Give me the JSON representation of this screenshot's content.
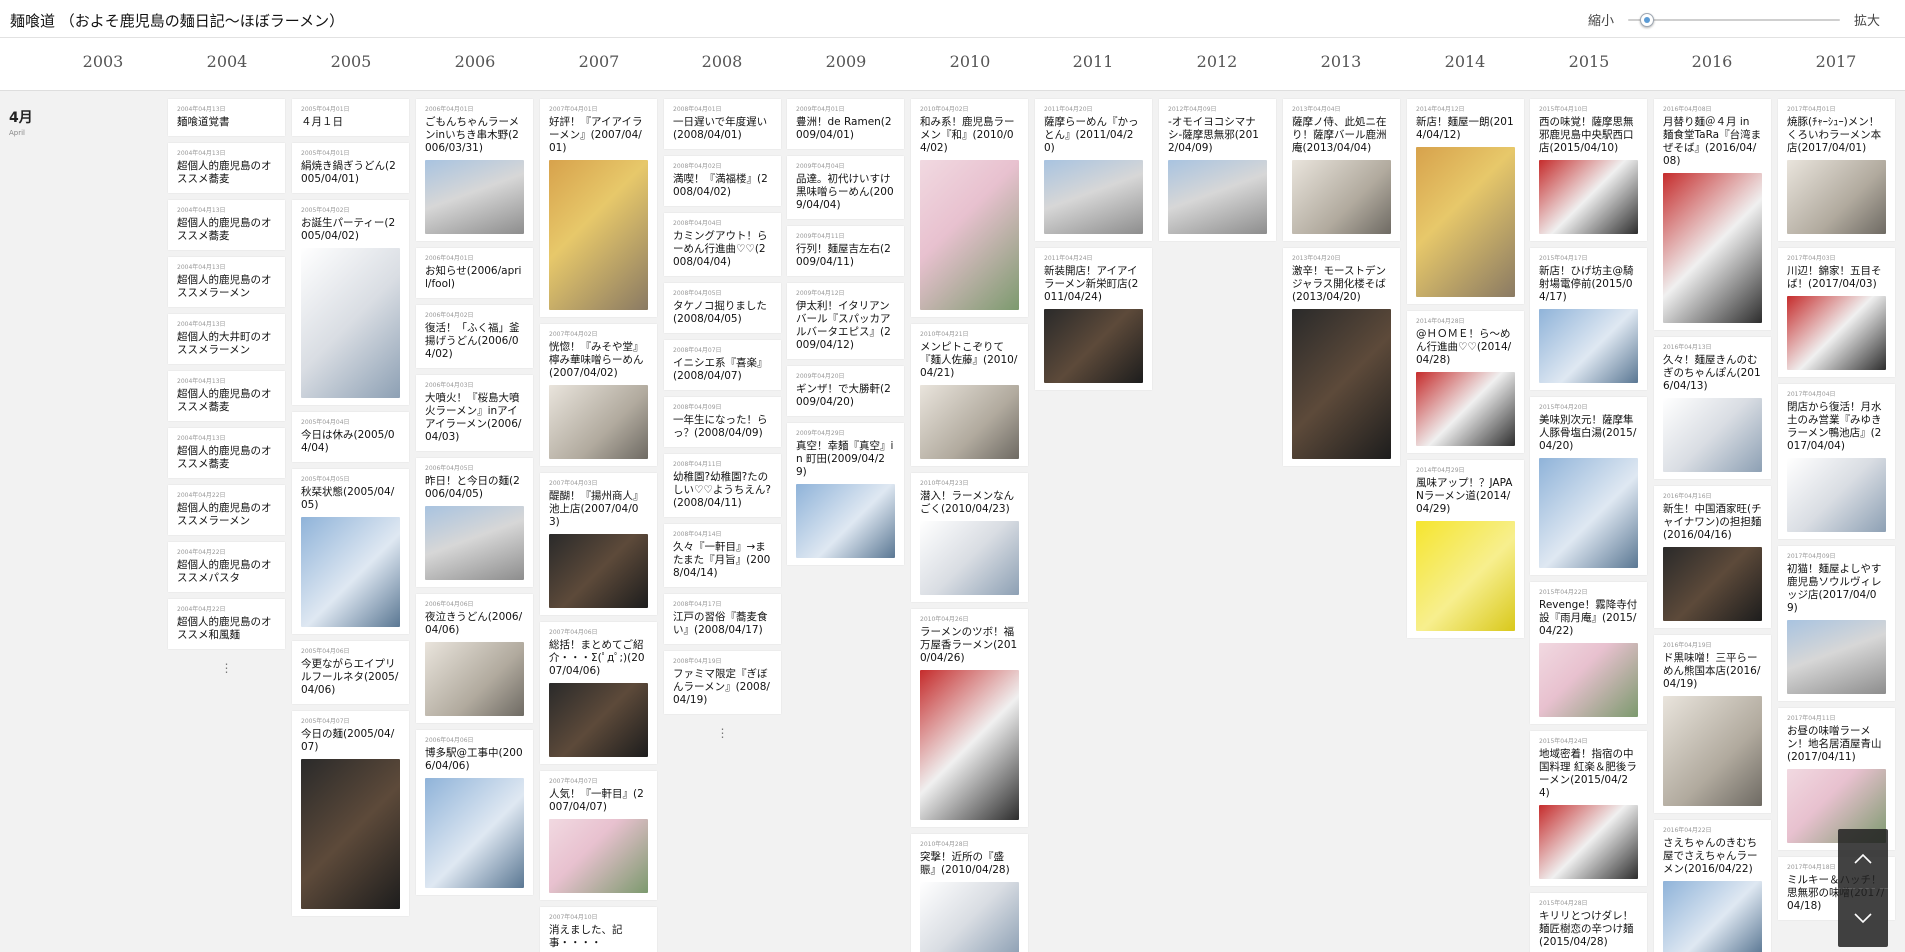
{
  "site_title": "麺喰道 （およそ鹿児島の麺日記〜ほぼラーメン）",
  "zoom": {
    "out_label": "縮小",
    "in_label": "拡大",
    "level": 0.06
  },
  "years": [
    "2003",
    "2004",
    "2005",
    "2006",
    "2007",
    "2008",
    "2009",
    "2010",
    "2011",
    "2012",
    "2013",
    "2014",
    "2015",
    "2016",
    "2017"
  ],
  "month": {
    "label": "4月",
    "sub": "April"
  },
  "more_glyph": "⋮",
  "columns": [
    {
      "year": "2004",
      "more": true,
      "items": [
        {
          "date": "2004年04月13日",
          "title": "麺喰道覚書"
        },
        {
          "date": "2004年04月13日",
          "title": "超個人的鹿児島のオススメ蕎麦"
        },
        {
          "date": "2004年04月13日",
          "title": "超個人的鹿児島のオススメ蕎麦"
        },
        {
          "date": "2004年04月13日",
          "title": "超個人的鹿児島のオススメラーメン"
        },
        {
          "date": "2004年04月13日",
          "title": "超個人的大井町のオススメラーメン"
        },
        {
          "date": "2004年04月13日",
          "title": "超個人的鹿児島のオススメ蕎麦"
        },
        {
          "date": "2004年04月13日",
          "title": "超個人的鹿児島のオススメ蕎麦"
        },
        {
          "date": "2004年04月22日",
          "title": "超個人的鹿児島のオススメラーメン"
        },
        {
          "date": "2004年04月22日",
          "title": "超個人的鹿児島のオススメパスタ"
        },
        {
          "date": "2004年04月22日",
          "title": "超個人的鹿児島のオススメ和風麺"
        }
      ]
    },
    {
      "year": "2005",
      "items": [
        {
          "date": "2005年04月01日",
          "title": "４月１日"
        },
        {
          "date": "2005年04月01日",
          "title": "絹焼き鍋ぎうどん(2005/04/01)"
        },
        {
          "date": "2005年04月02日",
          "title": "お誕生パーティー(2005/04/02)",
          "img": "t6",
          "size": "tall"
        },
        {
          "date": "2005年04月04日",
          "title": "今日は休み(2005/04/04)"
        },
        {
          "date": "2005年04月05日",
          "title": "秋栞状態(2005/04/05)",
          "img": "t9",
          "size": "mid"
        },
        {
          "date": "2005年04月06日",
          "title": "今更ながらエイプリルフールネタ(2005/04/06)"
        },
        {
          "date": "2005年04月07日",
          "title": "今日の麺(2005/04/07)",
          "img": "t3",
          "size": "tall"
        }
      ]
    },
    {
      "year": "2006",
      "items": [
        {
          "date": "2006年04月01日",
          "title": "ごもんちゃんラーメンinいちき串木野(2006/03/31)",
          "img": "t1"
        },
        {
          "date": "2006年04月01日",
          "title": "お知らせ(2006/april/fool)"
        },
        {
          "date": "2006年04月02日",
          "title": "復活！「ふく福」釜揚げうどん(2006/04/02)"
        },
        {
          "date": "2006年04月03日",
          "title": "大噴火！『桜島大噴火ラーメン』inアイアイラーメン(2006/04/03)"
        },
        {
          "date": "2006年04月05日",
          "title": "昨日！と今日の麺(2006/04/05)",
          "img": "t1"
        },
        {
          "date": "2006年04月06日",
          "title": "夜泣きうどん(2006/04/06)",
          "img": "t2"
        },
        {
          "date": "2006年04月06日",
          "title": "博多駅@工事中(2006/04/06)",
          "img": "t9",
          "size": "mid"
        }
      ]
    },
    {
      "year": "2007",
      "items": [
        {
          "date": "2007年04月01日",
          "title": "好評！『アイアイラーメン』(2007/04/01)",
          "img": "t5",
          "size": "tall"
        },
        {
          "date": "2007年04月02日",
          "title": "恍惚！『みそや堂』檸み華味噌らーめん(2007/04/02)",
          "img": "t2"
        },
        {
          "date": "2007年04月03日",
          "title": "醍醐！『揚州商人』池上店(2007/04/03)",
          "img": "t3"
        },
        {
          "date": "2007年04月06日",
          "title": "総括！まとめてご紹介・・・Σ(ﾟдﾟ;)(2007/04/06)",
          "img": "t3"
        },
        {
          "date": "2007年04月07日",
          "title": "人気！『一軒目』(2007/04/07)",
          "img": "t4"
        },
        {
          "date": "2007年04月10日",
          "title": "消えました、記事・・・・"
        }
      ]
    },
    {
      "year": "2008",
      "more": true,
      "items": [
        {
          "date": "2008年04月01日",
          "title": "一日遅いで年度遅い(2008/04/01)"
        },
        {
          "date": "2008年04月02日",
          "title": "満喫！『満福楼』(2008/04/02)"
        },
        {
          "date": "2008年04月04日",
          "title": "カミングアウト！らーめん行進曲♡♡(2008/04/04)"
        },
        {
          "date": "2008年04月05日",
          "title": "タケノコ掘りました(2008/04/05)"
        },
        {
          "date": "2008年04月07日",
          "title": "イニシエ系『喜楽』(2008/04/07)"
        },
        {
          "date": "2008年04月09日",
          "title": "一年生になった！らっ？(2008/04/09)"
        },
        {
          "date": "2008年04月11日",
          "title": "幼稚園?幼稚園?たのしい♡♡ようちえん?(2008/04/11)"
        },
        {
          "date": "2008年04月14日",
          "title": "久々『一軒目』→またまた『月旨』(2008/04/14)"
        },
        {
          "date": "2008年04月17日",
          "title": "江戸の習俗『蕎麦食い』(2008/04/17)"
        },
        {
          "date": "2008年04月19日",
          "title": "ファミマ限定『ぎぼんラーメン』(2008/04/19)"
        }
      ]
    },
    {
      "year": "2009",
      "items": [
        {
          "date": "2009年04月01日",
          "title": "豊洲！de Ramen(2009/04/01)"
        },
        {
          "date": "2009年04月04日",
          "title": "品達。初代けいすけ黒味噌らーめん(2009/04/04)"
        },
        {
          "date": "2009年04月11日",
          "title": "行列！麺屋吉左右(2009/04/11)"
        },
        {
          "date": "2009年04月12日",
          "title": "伊太利！イタリアンバール『スパッカアルバータエピス』(2009/04/12)"
        },
        {
          "date": "2009年04月20日",
          "title": "ギンザ！で大勝軒(2009/04/20)"
        },
        {
          "date": "2009年04月29日",
          "title": "真空！幸麺『真空』in 町田(2009/04/29)",
          "img": "t9"
        }
      ]
    },
    {
      "year": "2010",
      "items": [
        {
          "date": "2010年04月02日",
          "title": "和み系！鹿児島ラーメン『和』(2010/04/02)",
          "img": "t4",
          "size": "tall"
        },
        {
          "date": "2010年04月21日",
          "title": "メンピトこぞりて『麺人佐藤』(2010/04/21)",
          "img": "t2"
        },
        {
          "date": "2010年04月23日",
          "title": "潜入！ラーメンなんごく(2010/04/23)",
          "img": "t6"
        },
        {
          "date": "2010年04月26日",
          "title": "ラーメンのツボ！福万屋香ラーメン(2010/04/26)",
          "img": "t8",
          "size": "tall"
        },
        {
          "date": "2010年04月28日",
          "title": "突撃！近所の『盛賑』(2010/04/28)",
          "img": "t6"
        }
      ]
    },
    {
      "year": "2011",
      "items": [
        {
          "date": "2011年04月20日",
          "title": "薩摩らーめん『かっとん』(2011/04/20)",
          "img": "t1"
        },
        {
          "date": "2011年04月24日",
          "title": "新装開店！アイアイラーメン新栄町店(2011/04/24)",
          "img": "t3"
        }
      ]
    },
    {
      "year": "2012",
      "items": [
        {
          "date": "2012年04月09日",
          "title": "-オモイヨコシマナシ-薩摩思無邪(2012/04/09)",
          "img": "t1"
        }
      ]
    },
    {
      "year": "2013",
      "items": [
        {
          "date": "2013年04月04日",
          "title": "薩摩ノ侍、此処ニ在り！薩摩バール鹿洲庵(2013/04/04)",
          "img": "t2"
        },
        {
          "date": "2013年04月20日",
          "title": "激辛！モーストデンジャラス開化楼そば(2013/04/20)",
          "img": "t3",
          "size": "tall"
        }
      ]
    },
    {
      "year": "2014",
      "items": [
        {
          "date": "2014年04月12日",
          "title": "新店！麺屋一朗(2014/04/12)",
          "img": "t5",
          "size": "tall"
        },
        {
          "date": "2014年04月28日",
          "title": "@ＨＯＭＥ！ら〜めん行進曲♡♡(2014/04/28)",
          "img": "t8"
        },
        {
          "date": "2014年04月29日",
          "title": "風味アップ！？JAPANラーメン道(2014/04/29)",
          "img": "t7",
          "size": "mid"
        }
      ]
    },
    {
      "year": "2015",
      "items": [
        {
          "date": "2015年04月10日",
          "title": "西の味覚！薩摩思無邪鹿児島中央駅西口店(2015/04/10)",
          "img": "t8"
        },
        {
          "date": "2015年04月17日",
          "title": "新店！ひげ坊主@騎射場電停前(2015/04/17)",
          "img": "t9"
        },
        {
          "date": "2015年04月20日",
          "title": "美味別次元！薩摩隼人豚骨塩白湯(2015/04/20)",
          "img": "t9",
          "size": "mid"
        },
        {
          "date": "2015年04月22日",
          "title": "Revenge！霧降寺付設『雨月庵』(2015/04/22)",
          "img": "t4"
        },
        {
          "date": "2015年04月24日",
          "title": "地域密着！指宿の中国料理 紅楽＆肥後ラーメン(2015/04/24)",
          "img": "t8"
        },
        {
          "date": "2015年04月28日",
          "title": "キリリとつけダレ！麺匠樹恋の辛つけ麺(2015/04/28)"
        }
      ]
    },
    {
      "year": "2016",
      "items": [
        {
          "date": "2016年04月08日",
          "title": "月替り麺＠４月 in 麺食堂TaRa『台湾まぜそば』(2016/04/08)",
          "img": "t8",
          "size": "tall"
        },
        {
          "date": "2016年04月13日",
          "title": "久々！麺屋きんのむぎのちゃんぽん(2016/04/13)",
          "img": "t6"
        },
        {
          "date": "2016年04月16日",
          "title": "新生！中国酒家旺(チャイナワン)の担担麺(2016/04/16)",
          "img": "t3"
        },
        {
          "date": "2016年04月19日",
          "title": "ド黒味噌！三平らーめん熊国本店(2016/04/19)",
          "img": "t2",
          "size": "mid"
        },
        {
          "date": "2016年04月22日",
          "title": "さえちゃんのきむち屋でさえちゃんラーメン(2016/04/22)",
          "img": "t9"
        }
      ]
    },
    {
      "year": "2017",
      "items": [
        {
          "date": "2017年04月01日",
          "title": "焼豚(ﾁｬｰｼｭｰ)メン！くろいわラーメン本店(2017/04/01)",
          "img": "t2"
        },
        {
          "date": "2017年04月03日",
          "title": "川辺！錦家！五目そば！(2017/04/03)",
          "img": "t8"
        },
        {
          "date": "2017年04月04日",
          "title": "閉店から復活！月水土のみ営業『みゆきラーメン鴨池店』(2017/04/04)",
          "img": "t6"
        },
        {
          "date": "2017年04月09日",
          "title": "初猫！麺屋よしやす鹿児島ソウルヴィレッジ店(2017/04/09)",
          "img": "t1"
        },
        {
          "date": "2017年04月11日",
          "title": "お昼の味噌ラーメン！地名居酒屋青山(2017/04/11)",
          "img": "t4"
        },
        {
          "date": "2017年04月18日",
          "title": "ミルキー＆ハッチ！思無邪の味噌(2017/04/18)"
        }
      ]
    }
  ],
  "nav": {
    "up_icon": "chevron-up-icon",
    "down_icon": "chevron-down-icon"
  }
}
